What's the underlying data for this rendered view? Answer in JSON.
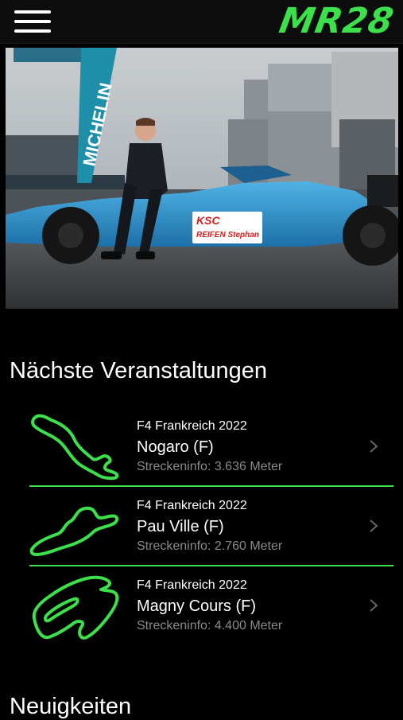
{
  "header": {
    "menu_icon": "hamburger-menu-icon",
    "logo_text": "MR28",
    "accent_color": "#3be04a"
  },
  "hero": {
    "banner_text": "MICHELIN",
    "car_sponsor_1": "KSC",
    "car_sponsor_2": "REIFEN Stephan"
  },
  "events_section": {
    "title": "Nächste Veranstaltungen",
    "items": [
      {
        "series": "F4 Frankreich 2022",
        "name": "Nogaro (F)",
        "info": "Streckeninfo: 3.636 Meter",
        "icon": "track-nogaro-icon"
      },
      {
        "series": "F4 Frankreich 2022",
        "name": "Pau Ville (F)",
        "info": "Streckeninfo: 2.760 Meter",
        "icon": "track-pau-icon"
      },
      {
        "series": "F4 Frankreich 2022",
        "name": "Magny Cours (F)",
        "info": "Streckeninfo: 4.400 Meter",
        "icon": "track-magny-cours-icon"
      }
    ]
  },
  "news_section": {
    "title": "Neuigkeiten"
  }
}
